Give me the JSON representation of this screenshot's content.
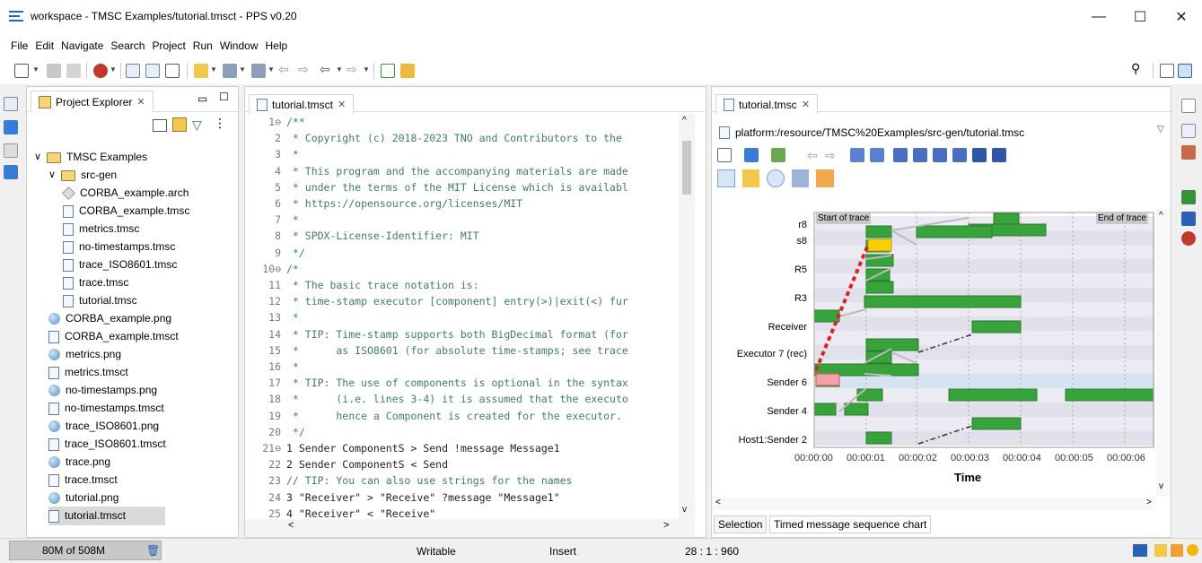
{
  "window": {
    "title": "workspace - TMSC Examples/tutorial.tmsct - PPS v0.20",
    "controls": {
      "minimize": "—",
      "maximize": "☐",
      "close": "✕"
    }
  },
  "menu": [
    "File",
    "Edit",
    "Navigate",
    "Search",
    "Project",
    "Run",
    "Window",
    "Help"
  ],
  "explorer": {
    "tab_label": "Project Explorer",
    "close": "✕",
    "items": [
      {
        "label": "TMSC Examples",
        "type": "project",
        "depth": 0
      },
      {
        "label": "src-gen",
        "type": "folder",
        "depth": 1
      },
      {
        "label": "CORBA_example.arch",
        "type": "arch",
        "depth": 2
      },
      {
        "label": "CORBA_example.tmsc",
        "type": "file",
        "depth": 2
      },
      {
        "label": "metrics.tmsc",
        "type": "file",
        "depth": 2
      },
      {
        "label": "no-timestamps.tmsc",
        "type": "file",
        "depth": 2
      },
      {
        "label": "trace_ISO8601.tmsc",
        "type": "file",
        "depth": 2
      },
      {
        "label": "trace.tmsc",
        "type": "file",
        "depth": 2
      },
      {
        "label": "tutorial.tmsc",
        "type": "file",
        "depth": 2
      },
      {
        "label": "CORBA_example.png",
        "type": "png",
        "depth": 1
      },
      {
        "label": "CORBA_example.tmsct",
        "type": "file",
        "depth": 1
      },
      {
        "label": "metrics.png",
        "type": "png",
        "depth": 1
      },
      {
        "label": "metrics.tmsct",
        "type": "file",
        "depth": 1
      },
      {
        "label": "no-timestamps.png",
        "type": "png",
        "depth": 1
      },
      {
        "label": "no-timestamps.tmsct",
        "type": "file",
        "depth": 1
      },
      {
        "label": "trace_ISO8601.png",
        "type": "png",
        "depth": 1
      },
      {
        "label": "trace_ISO8601.tmsct",
        "type": "file",
        "depth": 1
      },
      {
        "label": "trace.png",
        "type": "png",
        "depth": 1
      },
      {
        "label": "trace.tmsct",
        "type": "file",
        "depth": 1
      },
      {
        "label": "tutorial.png",
        "type": "png",
        "depth": 1
      },
      {
        "label": "tutorial.tmsct",
        "type": "file",
        "depth": 1,
        "selected": true
      }
    ]
  },
  "editor": {
    "tab_label": "tutorial.tmsct",
    "close": "✕",
    "lines": [
      {
        "n": "1⊖",
        "t": "/**",
        "c": "comment"
      },
      {
        "n": "2",
        "t": " * Copyright (c) 2018-2023 TNO and Contributors to the",
        "c": "comment"
      },
      {
        "n": "3",
        "t": " *",
        "c": "comment"
      },
      {
        "n": "4",
        "t": " * This program and the accompanying materials are made",
        "c": "comment"
      },
      {
        "n": "5",
        "t": " * under the terms of the MIT License which is availabl",
        "c": "comment"
      },
      {
        "n": "6",
        "t": " * https://opensource.org/licenses/MIT",
        "c": "comment"
      },
      {
        "n": "7",
        "t": " *",
        "c": "comment"
      },
      {
        "n": "8",
        "t": " * SPDX-License-Identifier: MIT",
        "c": "comment"
      },
      {
        "n": "9",
        "t": " */",
        "c": "comment"
      },
      {
        "n": "10⊖",
        "t": "/*",
        "c": "comment"
      },
      {
        "n": "11",
        "t": " * The basic trace notation is:",
        "c": "comment"
      },
      {
        "n": "12",
        "t": " * time-stamp executor [component] entry(>)|exit(<) fur",
        "c": "comment"
      },
      {
        "n": "13",
        "t": " *",
        "c": "comment"
      },
      {
        "n": "14",
        "t": " * TIP: Time-stamp supports both BigDecimal format (for",
        "c": "comment"
      },
      {
        "n": "15",
        "t": " *      as ISO8601 (for absolute time-stamps; see trace",
        "c": "comment"
      },
      {
        "n": "16",
        "t": " *",
        "c": "comment"
      },
      {
        "n": "17",
        "t": " * TIP: The use of components is optional in the syntax",
        "c": "comment"
      },
      {
        "n": "18",
        "t": " *      (i.e. lines 3-4) it is assumed that the executo",
        "c": "comment"
      },
      {
        "n": "19",
        "t": " *      hence a Component is created for the executor.",
        "c": "comment"
      },
      {
        "n": "20",
        "t": " */",
        "c": "comment"
      },
      {
        "n": "21⊖",
        "t": "1 Sender ComponentS > Send !message Message1",
        "c": "code"
      },
      {
        "n": "22",
        "t": "2 Sender ComponentS < Send",
        "c": "code"
      },
      {
        "n": "23",
        "t": "// TIP: You can also use strings for the names",
        "c": "comment"
      },
      {
        "n": "24",
        "t": "3 \"Receiver\" > \"Receive\" ?message \"Message1\"",
        "c": "code"
      },
      {
        "n": "25",
        "t": "4 \"Receiver\" < \"Receive\"",
        "c": "code"
      },
      {
        "n": "26",
        "t": "",
        "c": "code"
      }
    ]
  },
  "viewer": {
    "tab_label": "tutorial.tmsc",
    "close": "✕",
    "uri": "platform:/resource/TMSC%20Examples/src-gen/tutorial.tmsc",
    "start_label": "Start of trace",
    "end_label": "End of trace",
    "bottom_tabs": [
      "Selection",
      "Timed message sequence chart"
    ]
  },
  "chart_data": {
    "type": "timed message sequence chart",
    "xlabel": "Time",
    "xticks": [
      "00:00:00",
      "00:00:01",
      "00:00:02",
      "00:00:03",
      "00:00:04",
      "00:00:05",
      "00:00:06"
    ],
    "lanes": [
      "r8",
      "s8",
      "R5",
      "R3",
      "Receiver",
      "Executor 7 (rec)",
      "Sender 6",
      "Sender 4",
      "Host1:Sender 2"
    ]
  },
  "status": {
    "heap": "80M of 508M",
    "writable": "Writable",
    "insert": "Insert",
    "position": "28 : 1 : 960"
  }
}
